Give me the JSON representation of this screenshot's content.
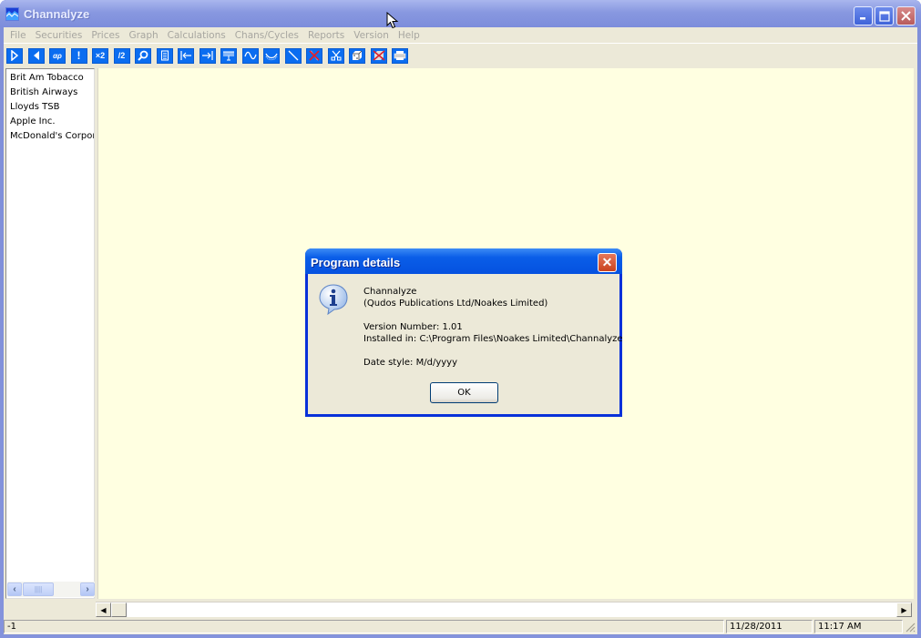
{
  "window": {
    "title": "Channalyze",
    "caption_buttons": {
      "minimize": "_",
      "maximize": "□",
      "close": "✕"
    }
  },
  "menubar": {
    "items": [
      {
        "label": "File"
      },
      {
        "label": "Securities"
      },
      {
        "label": "Prices"
      },
      {
        "label": "Graph"
      },
      {
        "label": "Calculations"
      },
      {
        "label": "Chans/Cycles"
      },
      {
        "label": "Reports"
      },
      {
        "label": "Version"
      },
      {
        "label": "Help"
      }
    ]
  },
  "toolbar": {
    "buttons": [
      {
        "icon": "play-forward-icon",
        "glyph": ""
      },
      {
        "icon": "play-back-icon",
        "glyph": ""
      },
      {
        "icon": "alpha-rho-icon",
        "glyph": "αρ"
      },
      {
        "icon": "exclamation-icon",
        "glyph": "!"
      },
      {
        "icon": "multiply-two-icon",
        "glyph": "×2"
      },
      {
        "icon": "divide-two-icon",
        "glyph": "/2"
      },
      {
        "icon": "magnifier-icon",
        "glyph": ""
      },
      {
        "icon": "document-list-icon",
        "glyph": ""
      },
      {
        "icon": "go-start-icon",
        "glyph": ""
      },
      {
        "icon": "go-end-icon",
        "glyph": ""
      },
      {
        "icon": "comb-filter-icon",
        "glyph": ""
      },
      {
        "icon": "sine-wave-icon",
        "glyph": ""
      },
      {
        "icon": "curve-channel-icon",
        "glyph": ""
      },
      {
        "icon": "trend-line-icon",
        "glyph": ""
      },
      {
        "icon": "delete-line-icon",
        "glyph": ""
      },
      {
        "icon": "scissors-icon",
        "glyph": ""
      },
      {
        "icon": "dice-icon",
        "glyph": ""
      },
      {
        "icon": "delete-dice-icon",
        "glyph": ""
      },
      {
        "icon": "printer-icon",
        "glyph": ""
      }
    ]
  },
  "securities": {
    "items": [
      {
        "label": "Brit Am Tobacco"
      },
      {
        "label": "British Airways"
      },
      {
        "label": "Lloyds TSB"
      },
      {
        "label": "Apple Inc."
      },
      {
        "label": "McDonald's Corpor."
      }
    ]
  },
  "dialog": {
    "title": "Program details",
    "close_glyph": "✕",
    "lines": [
      "Channalyze",
      "(Qudos Publications Ltd/Noakes Limited)",
      "",
      "Version Number: 1.01",
      "Installed in: C:\\Program Files\\Noakes Limited\\Channalyze",
      "",
      "Date style: M/d/yyyy"
    ],
    "ok_label": "OK"
  },
  "statusbar": {
    "left": "-1",
    "date": "11/28/2011",
    "time": "11:17 AM"
  },
  "scroll": {
    "left_arrow": "◀",
    "right_arrow": "▶",
    "small_left": "‹",
    "small_right": "›"
  },
  "colors": {
    "toolbar_button": "#0b6df0",
    "chart_area": "#ffffe1",
    "title_active": "#0551e0"
  }
}
